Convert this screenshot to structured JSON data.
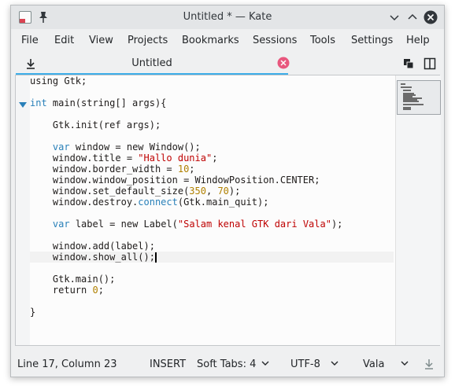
{
  "window": {
    "title": "Untitled * — Kate",
    "app_icon": "kate-app-icon",
    "buttons": [
      "minimize-icon",
      "maximize-icon",
      "close-icon"
    ]
  },
  "menu": [
    "File",
    "Edit",
    "View",
    "Projects",
    "Bookmarks",
    "Sessions",
    "Tools",
    "Settings",
    "Help"
  ],
  "tab": {
    "label": "Untitled",
    "accent": "#3daee9",
    "close_color": "#e8577e"
  },
  "code_lines": [
    "using Gtk;",
    "",
    "int main(string[] args){",
    "",
    "    Gtk.init(ref args);",
    "",
    "    var window = new Window();",
    "    window.title = \"Hallo dunia\";",
    "    window.border_width = 10;",
    "    window.window_position = WindowPosition.CENTER;",
    "    window.set_default_size(350, 70);",
    "    window.destroy.connect(Gtk.main_quit);",
    "",
    "    var label = new Label(\"Salam kenal GTK dari Vala\");",
    "",
    "    window.add(label);",
    "    window.show_all();",
    "",
    "    Gtk.main();",
    "    return 0;",
    "",
    "}"
  ],
  "status": {
    "position": "Line 17, Column 23",
    "mode": "INSERT",
    "indent": "Soft Tabs: 4",
    "encoding": "UTF-8",
    "syntax": "Vala"
  },
  "colors": {
    "keyword": "#2980b9",
    "string": "#bf0303",
    "number": "#b08000"
  }
}
